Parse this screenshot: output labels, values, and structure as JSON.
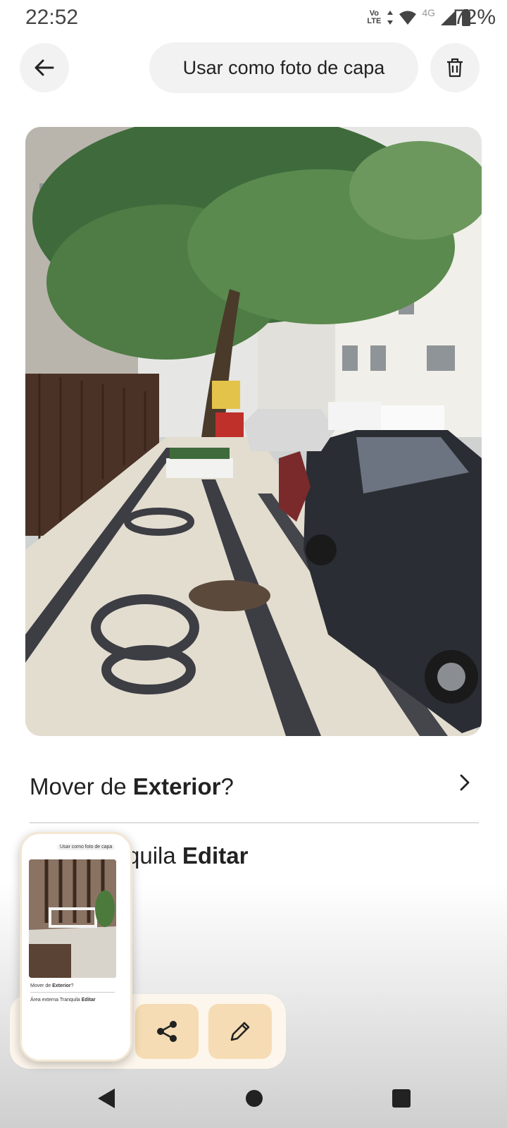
{
  "status": {
    "time": "22:52",
    "volte_top": "Vo",
    "volte_bottom": "LTE",
    "network": "4G",
    "battery": "72%"
  },
  "header": {
    "back_icon": "arrow-left-icon",
    "cover_label": "Usar como foto de capa",
    "delete_icon": "trash-icon"
  },
  "photo": {
    "description": "street-photo"
  },
  "move_row": {
    "prefix": "Mover de ",
    "room": "Exterior",
    "suffix": "?"
  },
  "edit_row": {
    "visible_text": "quila ",
    "action": "Editar"
  },
  "toolbar": {
    "share_icon": "share-icon",
    "edit_icon": "pencil-icon"
  },
  "thumbnail": {
    "cover_label": "Usar como foto de capa",
    "move_prefix": "Mover de ",
    "move_room": "Exterior",
    "move_suffix": "?",
    "edit_text": "Área externa Tranquila ",
    "edit_action": "Editar"
  },
  "nav": {
    "back": "nav-back-icon",
    "home": "nav-home-icon",
    "recents": "nav-recents-icon"
  }
}
